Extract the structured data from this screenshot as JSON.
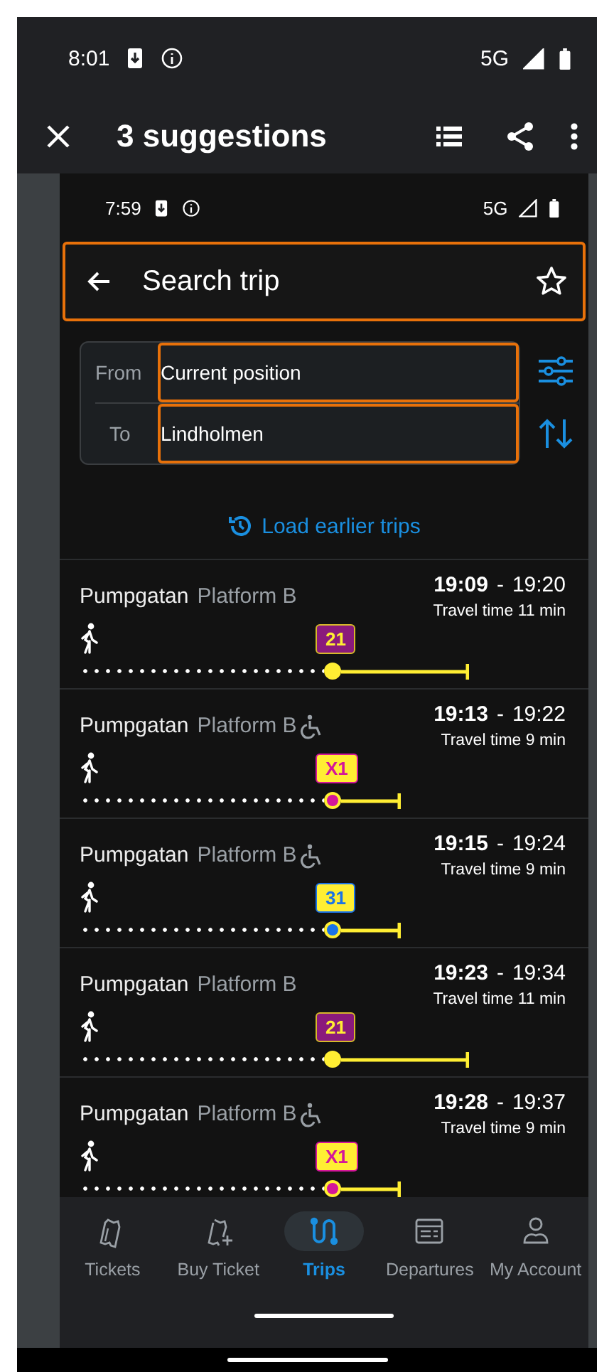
{
  "outer_status_bar": {
    "time": "8:01",
    "network": "5G"
  },
  "outer_app_bar": {
    "title": "3 suggestions"
  },
  "inner_status_bar": {
    "time": "7:59",
    "network": "5G"
  },
  "header": {
    "title": "Search trip"
  },
  "search_form": {
    "from": {
      "label": "From",
      "value": "Current position"
    },
    "to": {
      "label": "To",
      "value": "Lindholmen"
    }
  },
  "load_earlier": "Load earlier trips",
  "trips": [
    {
      "stop": "Pumpgatan",
      "platform": "Platform B",
      "accessible": false,
      "departure": "19:09",
      "separator": "-",
      "arrival": "19:20",
      "travel_time": "Travel time 11 min",
      "line": {
        "label": "21",
        "kind": "dark",
        "color": "#ffee33"
      }
    },
    {
      "stop": "Pumpgatan",
      "platform": "Platform B",
      "accessible": true,
      "departure": "19:13",
      "separator": "-",
      "arrival": "19:22",
      "travel_time": "Travel time 9 min",
      "line": {
        "label": "X1",
        "kind": "light",
        "color": "#d4169a"
      }
    },
    {
      "stop": "Pumpgatan",
      "platform": "Platform B",
      "accessible": true,
      "departure": "19:15",
      "separator": "-",
      "arrival": "19:24",
      "travel_time": "Travel time 9 min",
      "line": {
        "label": "31",
        "kind": "light",
        "color": "#1a73e8"
      }
    },
    {
      "stop": "Pumpgatan",
      "platform": "Platform B",
      "accessible": false,
      "departure": "19:23",
      "separator": "-",
      "arrival": "19:34",
      "travel_time": "Travel time 11 min",
      "line": {
        "label": "21",
        "kind": "dark",
        "color": "#ffee33"
      }
    },
    {
      "stop": "Pumpgatan",
      "platform": "Platform B",
      "accessible": true,
      "departure": "19:28",
      "separator": "-",
      "arrival": "19:37",
      "travel_time": "Travel time 9 min",
      "line": {
        "label": "X1",
        "kind": "light",
        "color": "#d4169a"
      }
    }
  ],
  "bottom_nav": [
    {
      "label": "Tickets",
      "selected": false
    },
    {
      "label": "Buy Ticket",
      "selected": false
    },
    {
      "label": "Trips",
      "selected": true
    },
    {
      "label": "Departures",
      "selected": false
    },
    {
      "label": "My Account",
      "selected": false
    }
  ]
}
